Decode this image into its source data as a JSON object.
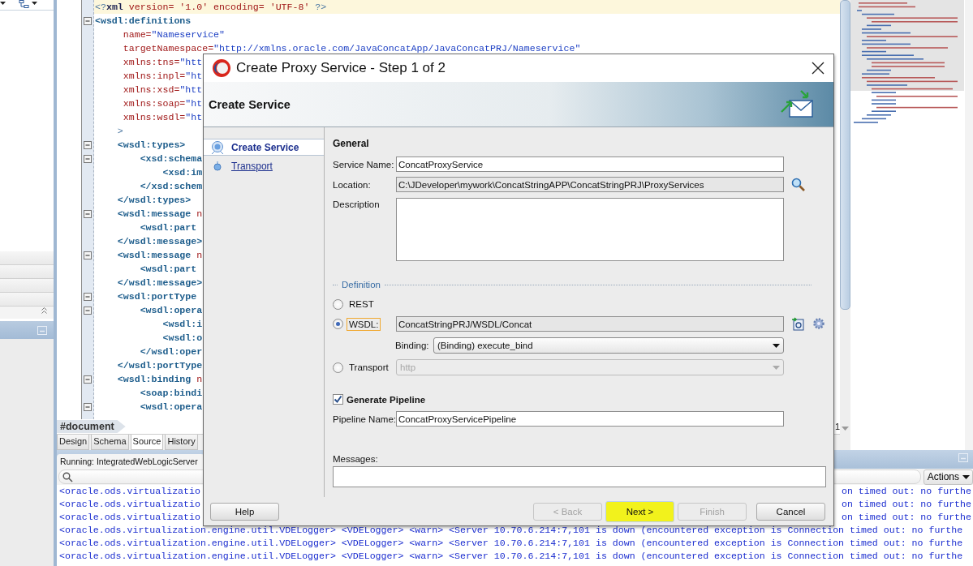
{
  "editor": {
    "lines": [
      {
        "current": true,
        "foldable": false,
        "parts": [
          {
            "kind": "punct",
            "text": "<?"
          },
          {
            "kind": "name",
            "text": "xml"
          },
          {
            "kind": "attr",
            "text": " version= '1.0' encoding= 'UTF-8'"
          },
          {
            "kind": "punct",
            "text": " ?>"
          }
        ]
      },
      {
        "current": false,
        "foldable": true,
        "parts": [
          {
            "kind": "tag",
            "text": "<wsdl:definitions"
          }
        ]
      },
      {
        "current": false,
        "foldable": false,
        "parts": [
          {
            "kind": "attr",
            "text": "     name="
          },
          {
            "kind": "value",
            "text": "\"Nameservice\""
          }
        ]
      },
      {
        "current": false,
        "foldable": false,
        "parts": [
          {
            "kind": "attr",
            "text": "     targetNamespace="
          },
          {
            "kind": "value",
            "text": "\"http://xmlns.oracle.com/JavaConcatApp/JavaConcatPRJ/Nameservice\""
          }
        ]
      },
      {
        "current": false,
        "foldable": false,
        "parts": [
          {
            "kind": "attr",
            "text": "     xmlns:tns="
          },
          {
            "kind": "value",
            "text": "\"htt"
          }
        ]
      },
      {
        "current": false,
        "foldable": false,
        "parts": [
          {
            "kind": "attr",
            "text": "     xmlns:inpl="
          },
          {
            "kind": "value",
            "text": "\"ht"
          }
        ]
      },
      {
        "current": false,
        "foldable": false,
        "parts": [
          {
            "kind": "attr",
            "text": "     xmlns:xsd="
          },
          {
            "kind": "value",
            "text": "\"htt"
          }
        ]
      },
      {
        "current": false,
        "foldable": false,
        "parts": [
          {
            "kind": "attr",
            "text": "     xmlns:soap="
          },
          {
            "kind": "value",
            "text": "\"ht"
          }
        ]
      },
      {
        "current": false,
        "foldable": false,
        "parts": [
          {
            "kind": "attr",
            "text": "     xmlns:wsdl="
          },
          {
            "kind": "value",
            "text": "\"ht"
          }
        ]
      },
      {
        "current": false,
        "foldable": false,
        "parts": [
          {
            "kind": "punct",
            "text": "    >"
          }
        ]
      },
      {
        "current": false,
        "foldable": true,
        "parts": [
          {
            "kind": "tag",
            "text": "    <wsdl:types>"
          }
        ]
      },
      {
        "current": false,
        "foldable": true,
        "parts": [
          {
            "kind": "tag",
            "text": "        <xsd:schema"
          }
        ]
      },
      {
        "current": false,
        "foldable": false,
        "parts": [
          {
            "kind": "tag",
            "text": "            <xsd:im"
          }
        ]
      },
      {
        "current": false,
        "foldable": false,
        "parts": [
          {
            "kind": "tag",
            "text": "        </xsd:schem"
          }
        ]
      },
      {
        "current": false,
        "foldable": false,
        "parts": [
          {
            "kind": "tag",
            "text": "    </wsdl:types>"
          }
        ]
      },
      {
        "current": false,
        "foldable": true,
        "parts": [
          {
            "kind": "tag",
            "text": "    <wsdl:message"
          },
          {
            "kind": "attr",
            "text": " n"
          }
        ]
      },
      {
        "current": false,
        "foldable": false,
        "parts": [
          {
            "kind": "tag",
            "text": "        <wsdl:part"
          }
        ]
      },
      {
        "current": false,
        "foldable": false,
        "parts": [
          {
            "kind": "tag",
            "text": "    </wsdl:message>"
          }
        ]
      },
      {
        "current": false,
        "foldable": true,
        "parts": [
          {
            "kind": "tag",
            "text": "    <wsdl:message"
          },
          {
            "kind": "attr",
            "text": " n"
          }
        ]
      },
      {
        "current": false,
        "foldable": false,
        "parts": [
          {
            "kind": "tag",
            "text": "        <wsdl:part"
          }
        ]
      },
      {
        "current": false,
        "foldable": false,
        "parts": [
          {
            "kind": "tag",
            "text": "    </wsdl:message>"
          }
        ]
      },
      {
        "current": false,
        "foldable": true,
        "parts": [
          {
            "kind": "tag",
            "text": "    <wsdl:portType"
          }
        ]
      },
      {
        "current": false,
        "foldable": true,
        "parts": [
          {
            "kind": "tag",
            "text": "        <wsdl:opera"
          }
        ]
      },
      {
        "current": false,
        "foldable": false,
        "parts": [
          {
            "kind": "tag",
            "text": "            <wsdl:i"
          }
        ]
      },
      {
        "current": false,
        "foldable": false,
        "parts": [
          {
            "kind": "tag",
            "text": "            <wsdl:o"
          }
        ]
      },
      {
        "current": false,
        "foldable": false,
        "parts": [
          {
            "kind": "tag",
            "text": "        </wsdl:oper"
          }
        ]
      },
      {
        "current": false,
        "foldable": false,
        "parts": [
          {
            "kind": "tag",
            "text": "    </wsdl:portType"
          }
        ]
      },
      {
        "current": false,
        "foldable": true,
        "parts": [
          {
            "kind": "tag",
            "text": "    <wsdl:binding"
          },
          {
            "kind": "attr",
            "text": " n"
          }
        ]
      },
      {
        "current": false,
        "foldable": false,
        "parts": [
          {
            "kind": "tag",
            "text": "        <soap:bindi"
          }
        ]
      },
      {
        "current": false,
        "foldable": true,
        "parts": [
          {
            "kind": "tag",
            "text": "        <wsdl:opera"
          }
        ]
      }
    ],
    "breadcrumb": "#document",
    "column_indicator": "1",
    "tabs": [
      {
        "label": "Design",
        "selected": false
      },
      {
        "label": "Schema",
        "selected": false
      },
      {
        "label": "Source",
        "selected": true
      },
      {
        "label": "History",
        "selected": false
      }
    ]
  },
  "log": {
    "title": "Running: IntegratedWebLogicServer",
    "actions": "Actions",
    "rows": [
      {
        "start": "<oracle.ods.virtualizatio",
        "end": "on timed out: no furthe"
      },
      {
        "start": "<oracle.ods.virtualizatio",
        "end": "on timed out: no furthe"
      },
      {
        "start": "<oracle.ods.virtualizatio",
        "end": "on timed out: no furthe"
      },
      {
        "text": "<oracle.ods.virtualization.engine.util.VDELogger> <VDELogger> <warn> <Server 10.70.6.214:7,101 is down (encountered exception is Connection timed out: no furthe"
      },
      {
        "text": "<oracle.ods.virtualization.engine.util.VDELogger> <VDELogger> <warn> <Server 10.70.6.214:7,101 is down (encountered exception is Connection timed out: no furthe"
      },
      {
        "text": "<oracle.ods.virtualization.engine.util.VDELogger> <VDELogger> <warn> <Server 10.70.6.214:7,101 is down (encountered exception is Connection timed out: no furthe"
      }
    ]
  },
  "dialog": {
    "title": "Create Proxy Service - Step 1 of 2",
    "banner_title": "Create Service",
    "steps": [
      {
        "label": "Create Service",
        "selected": true
      },
      {
        "label": "Transport",
        "selected": false
      }
    ],
    "section": "General",
    "service_name": {
      "label": "Service Name:",
      "value": "ConcatProxyService"
    },
    "location": {
      "label": "Location:",
      "value": "C:\\JDeveloper\\mywork\\ConcatStringAPP\\ConcatStringPRJ\\ProxyServices"
    },
    "description": {
      "label": "Description"
    },
    "definition": {
      "title": "Definition",
      "options": [
        {
          "kind": "plain",
          "label": "REST",
          "selected": false,
          "focused": false
        },
        {
          "kind": "field",
          "label": "WSDL:",
          "selected": true,
          "focused": true,
          "value": "ConcatStringPRJ/WSDL/Concat",
          "binding": {
            "label": "Binding:",
            "value": "(Binding) execute_bind"
          }
        },
        {
          "kind": "select",
          "label": "Transport",
          "selected": false,
          "focused": false,
          "value": "http"
        }
      ]
    },
    "generate_pipeline": {
      "label": "Generate Pipeline",
      "checked": true
    },
    "pipeline_name": {
      "label": "Pipeline Name:",
      "value": "ConcatProxyServicePipeline"
    },
    "messages": {
      "label": "Messages:"
    },
    "help_button": {
      "label": "Help",
      "disabled": false,
      "highlighted": false
    },
    "buttons": [
      {
        "label": "< Back",
        "disabled": true,
        "highlighted": false
      },
      {
        "label": "Next >",
        "disabled": false,
        "highlighted": true
      },
      {
        "label": "Finish",
        "disabled": true,
        "highlighted": false
      },
      {
        "label": "Cancel",
        "disabled": false,
        "highlighted": false
      }
    ]
  }
}
